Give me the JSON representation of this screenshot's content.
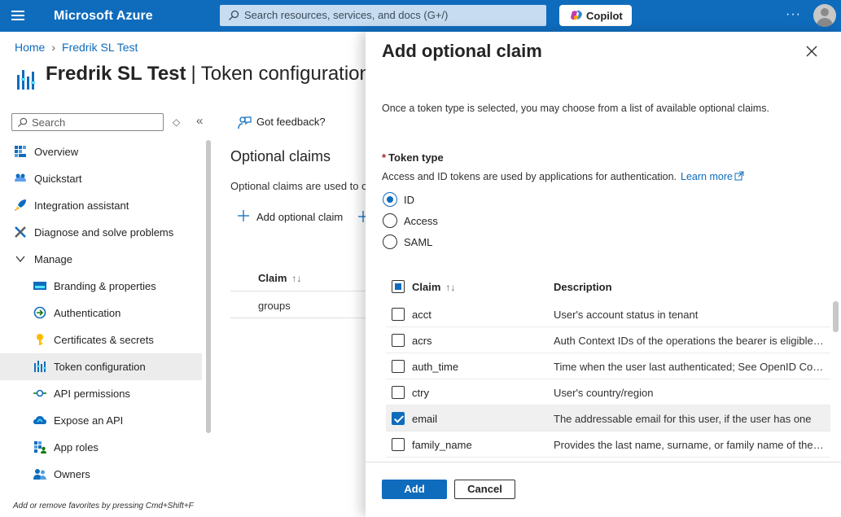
{
  "topbar": {
    "brand": "Microsoft Azure",
    "search_placeholder": "Search resources, services, and docs (G+/)",
    "copilot_label": "Copilot",
    "more_label": "···"
  },
  "breadcrumb": {
    "home": "Home",
    "app": "Fredrik SL Test"
  },
  "page": {
    "title_app": "Fredrik SL Test",
    "title_section": "Token configuration",
    "separator": "|"
  },
  "sidebar": {
    "search_placeholder": "Search",
    "collapse_label": "«",
    "sort_label": "◇",
    "items": [
      {
        "label": "Overview",
        "icon": "overview-icon",
        "sub": false
      },
      {
        "label": "Quickstart",
        "icon": "quickstart-icon",
        "sub": false
      },
      {
        "label": "Integration assistant",
        "icon": "rocket-icon",
        "sub": false
      },
      {
        "label": "Diagnose and solve problems",
        "icon": "tools-icon",
        "sub": false
      },
      {
        "label": "Manage",
        "icon": "chevron-down-icon",
        "sub": false
      },
      {
        "label": "Branding & properties",
        "icon": "branding-icon",
        "sub": true
      },
      {
        "label": "Authentication",
        "icon": "authentication-icon",
        "sub": true
      },
      {
        "label": "Certificates & secrets",
        "icon": "key-icon",
        "sub": true
      },
      {
        "label": "Token configuration",
        "icon": "token-icon",
        "sub": true,
        "active": true
      },
      {
        "label": "API permissions",
        "icon": "api-permissions-icon",
        "sub": true
      },
      {
        "label": "Expose an API",
        "icon": "cloud-icon",
        "sub": true
      },
      {
        "label": "App roles",
        "icon": "app-roles-icon",
        "sub": true
      },
      {
        "label": "Owners",
        "icon": "owners-icon",
        "sub": true
      }
    ],
    "footer_hint": "Add or remove favorites by pressing Cmd+Shift+F"
  },
  "main": {
    "feedback_label": "Got feedback?",
    "section_title": "Optional claims",
    "section_desc": "Optional claims are used to c",
    "add_claim_label": "Add optional claim",
    "col_claim": "Claim",
    "rows": [
      "groups"
    ]
  },
  "panel": {
    "title": "Add optional claim",
    "intro": "Once a token type is selected, you may choose from a list of available optional claims.",
    "token_type_label": "Token type",
    "required_mark": "*",
    "token_help": "Access and ID tokens are used by applications for authentication.",
    "learn_more": "Learn more",
    "token_types": [
      {
        "label": "ID",
        "selected": true
      },
      {
        "label": "Access",
        "selected": false
      },
      {
        "label": "SAML",
        "selected": false
      }
    ],
    "col_claim": "Claim",
    "col_desc": "Description",
    "sort_glyph": "↑↓",
    "claims": [
      {
        "name": "acct",
        "desc": "User's account status in tenant",
        "checked": false
      },
      {
        "name": "acrs",
        "desc": "Auth Context IDs of the operations the bearer is eligible to perform",
        "checked": false
      },
      {
        "name": "auth_time",
        "desc": "Time when the user last authenticated; See OpenID Connect spec",
        "checked": false
      },
      {
        "name": "ctry",
        "desc": "User's country/region",
        "checked": false
      },
      {
        "name": "email",
        "desc": "The addressable email for this user, if the user has one",
        "checked": true
      },
      {
        "name": "family_name",
        "desc": "Provides the last name, surname, or family name of the user",
        "checked": false
      }
    ],
    "add_label": "Add",
    "cancel_label": "Cancel"
  }
}
